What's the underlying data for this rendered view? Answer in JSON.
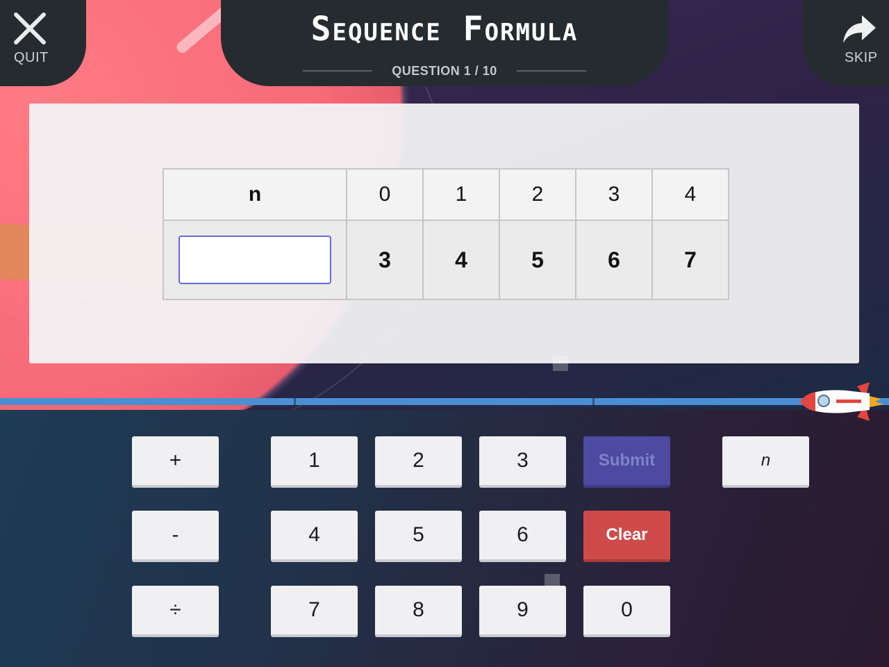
{
  "header": {
    "quit_label": "QUIT",
    "skip_label": "SKIP",
    "title": "Sequence Formula",
    "question_progress": "QUESTION 1 / 10"
  },
  "table": {
    "row_label": "n",
    "n_values": [
      "0",
      "1",
      "2",
      "3",
      "4"
    ],
    "sequence_values": [
      "3",
      "4",
      "5",
      "6",
      "7"
    ],
    "answer_value": ""
  },
  "progress": {
    "question_current": 1,
    "question_total": 10
  },
  "keypad": {
    "plus": "+",
    "minus": "-",
    "divide": "÷",
    "digits": [
      "1",
      "2",
      "3",
      "4",
      "5",
      "6",
      "7",
      "8",
      "9",
      "0"
    ],
    "submit": "Submit",
    "clear": "Clear",
    "variable": "n"
  },
  "colors": {
    "submit_bg": "#4c4ba1",
    "clear_bg": "#cf4b4b",
    "progress_bar": "#4a8fd3",
    "header_panel": "#262b2f"
  },
  "icons": {
    "quit": "close-icon",
    "skip": "share-arrow-icon",
    "progress_marker": "rocket-icon"
  }
}
